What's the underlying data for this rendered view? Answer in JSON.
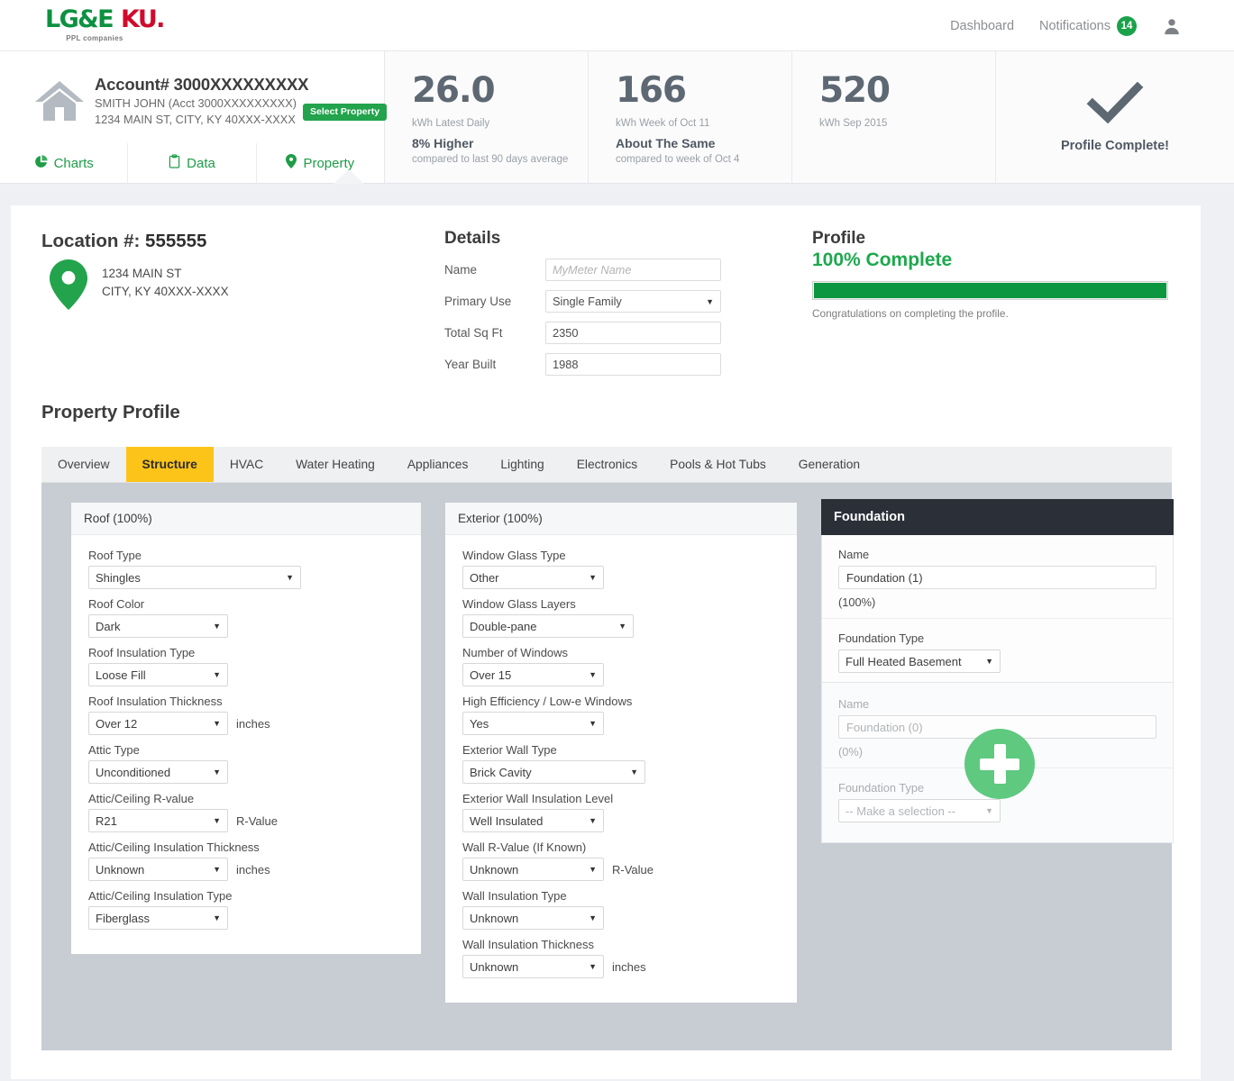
{
  "brand": {
    "logo_primary": "LG&E",
    "logo_secondary": "KU.",
    "logo_tagline": "PPL companies"
  },
  "topnav": {
    "dashboard": "Dashboard",
    "notifications": "Notifications",
    "notifications_count": "14",
    "avatar_icon": "user-icon"
  },
  "account": {
    "title": "Account# 3000XXXXXXXXX",
    "name_line": "SMITH JOHN  (Acct 3000XXXXXXXXX)",
    "address_line": "1234 MAIN ST, CITY, KY 40XXX-XXXX",
    "select_property": "Select Property",
    "tabs": [
      {
        "label": "Charts",
        "icon": "pie-chart-icon",
        "active": false
      },
      {
        "label": "Data",
        "icon": "clipboard-icon",
        "active": false
      },
      {
        "label": "Property",
        "icon": "map-pin-icon",
        "active": true
      }
    ]
  },
  "stats": [
    {
      "value": "26.0",
      "unit": "kWh Latest Daily",
      "comparison": "8% Higher",
      "note": "compared to last 90 days average"
    },
    {
      "value": "166",
      "unit": "kWh Week of Oct 11",
      "comparison": "About The Same",
      "note": "compared to week of Oct 4"
    },
    {
      "value": "520",
      "unit": "kWh Sep 2015",
      "comparison": "",
      "note": ""
    }
  ],
  "profile_status": {
    "icon": "checkmark-icon",
    "label": "Profile Complete!"
  },
  "location": {
    "label": "Location #:",
    "number": "555555",
    "address_line1": "1234 MAIN ST",
    "address_line2": "CITY, KY 40XXX-XXXX",
    "pin_icon": "map-pin-icon"
  },
  "details": {
    "heading": "Details",
    "fields": [
      {
        "label": "Name",
        "value": "",
        "placeholder": "MyMeter Name",
        "type": "text"
      },
      {
        "label": "Primary Use",
        "value": "Single Family",
        "type": "select"
      },
      {
        "label": "Total Sq Ft",
        "value": "2350",
        "type": "text"
      },
      {
        "label": "Year Built",
        "value": "1988",
        "type": "text"
      }
    ]
  },
  "profile": {
    "heading": "Profile",
    "percent_label": "100% Complete",
    "percent_value": 100,
    "note": "Congratulations on completing the profile.",
    "bar_color": "#0c9640"
  },
  "property_profile": {
    "heading": "Property Profile",
    "tabs": [
      {
        "label": "Overview",
        "active": false
      },
      {
        "label": "Structure",
        "active": true
      },
      {
        "label": "HVAC",
        "active": false
      },
      {
        "label": "Water Heating",
        "active": false
      },
      {
        "label": "Appliances",
        "active": false
      },
      {
        "label": "Lighting",
        "active": false
      },
      {
        "label": "Electronics",
        "active": false
      },
      {
        "label": "Pools & Hot Tubs",
        "active": false
      },
      {
        "label": "Generation",
        "active": false
      }
    ],
    "active_tab_color": "#fcc419"
  },
  "roof_panel": {
    "title": "Roof (100%)",
    "fields": [
      {
        "label": "Roof Type",
        "value": "Shingles",
        "unit": ""
      },
      {
        "label": "Roof Color",
        "value": "Dark",
        "unit": ""
      },
      {
        "label": "Roof Insulation Type",
        "value": "Loose Fill",
        "unit": ""
      },
      {
        "label": "Roof Insulation Thickness",
        "value": "Over 12",
        "unit": "inches"
      },
      {
        "label": "Attic Type",
        "value": "Unconditioned",
        "unit": ""
      },
      {
        "label": "Attic/Ceiling R-value",
        "value": "R21",
        "unit": "R-Value"
      },
      {
        "label": "Attic/Ceiling Insulation Thickness",
        "value": "Unknown",
        "unit": "inches"
      },
      {
        "label": "Attic/Ceiling Insulation Type",
        "value": "Fiberglass",
        "unit": ""
      }
    ]
  },
  "exterior_panel": {
    "title": "Exterior (100%)",
    "fields": [
      {
        "label": "Window Glass Type",
        "value": "Other",
        "unit": ""
      },
      {
        "label": "Window Glass Layers",
        "value": "Double-pane",
        "unit": ""
      },
      {
        "label": "Number of Windows",
        "value": "Over 15",
        "unit": ""
      },
      {
        "label": "High Efficiency / Low-e Windows",
        "value": "Yes",
        "unit": ""
      },
      {
        "label": "Exterior Wall Type",
        "value": "Brick Cavity",
        "unit": ""
      },
      {
        "label": "Exterior Wall Insulation Level",
        "value": "Well Insulated",
        "unit": ""
      },
      {
        "label": "Wall R-Value (If Known)",
        "value": "Unknown",
        "unit": "R-Value"
      },
      {
        "label": "Wall Insulation Type",
        "value": "Unknown",
        "unit": ""
      },
      {
        "label": "Wall Insulation Thickness",
        "value": "Unknown",
        "unit": "inches"
      }
    ]
  },
  "foundation_panel": {
    "title": "Foundation",
    "entries": [
      {
        "name_label": "Name",
        "name_value": "Foundation (1)",
        "percent": "(100%)",
        "type_label": "Foundation Type",
        "type_value": "Full Heated Basement"
      },
      {
        "name_label": "Name",
        "name_value": "Foundation (0)",
        "percent": "(0%)",
        "type_label": "Foundation Type",
        "type_value": "-- Make a selection --"
      }
    ],
    "add_button_icon": "plus-icon",
    "add_button_color": "#5ec97f"
  }
}
